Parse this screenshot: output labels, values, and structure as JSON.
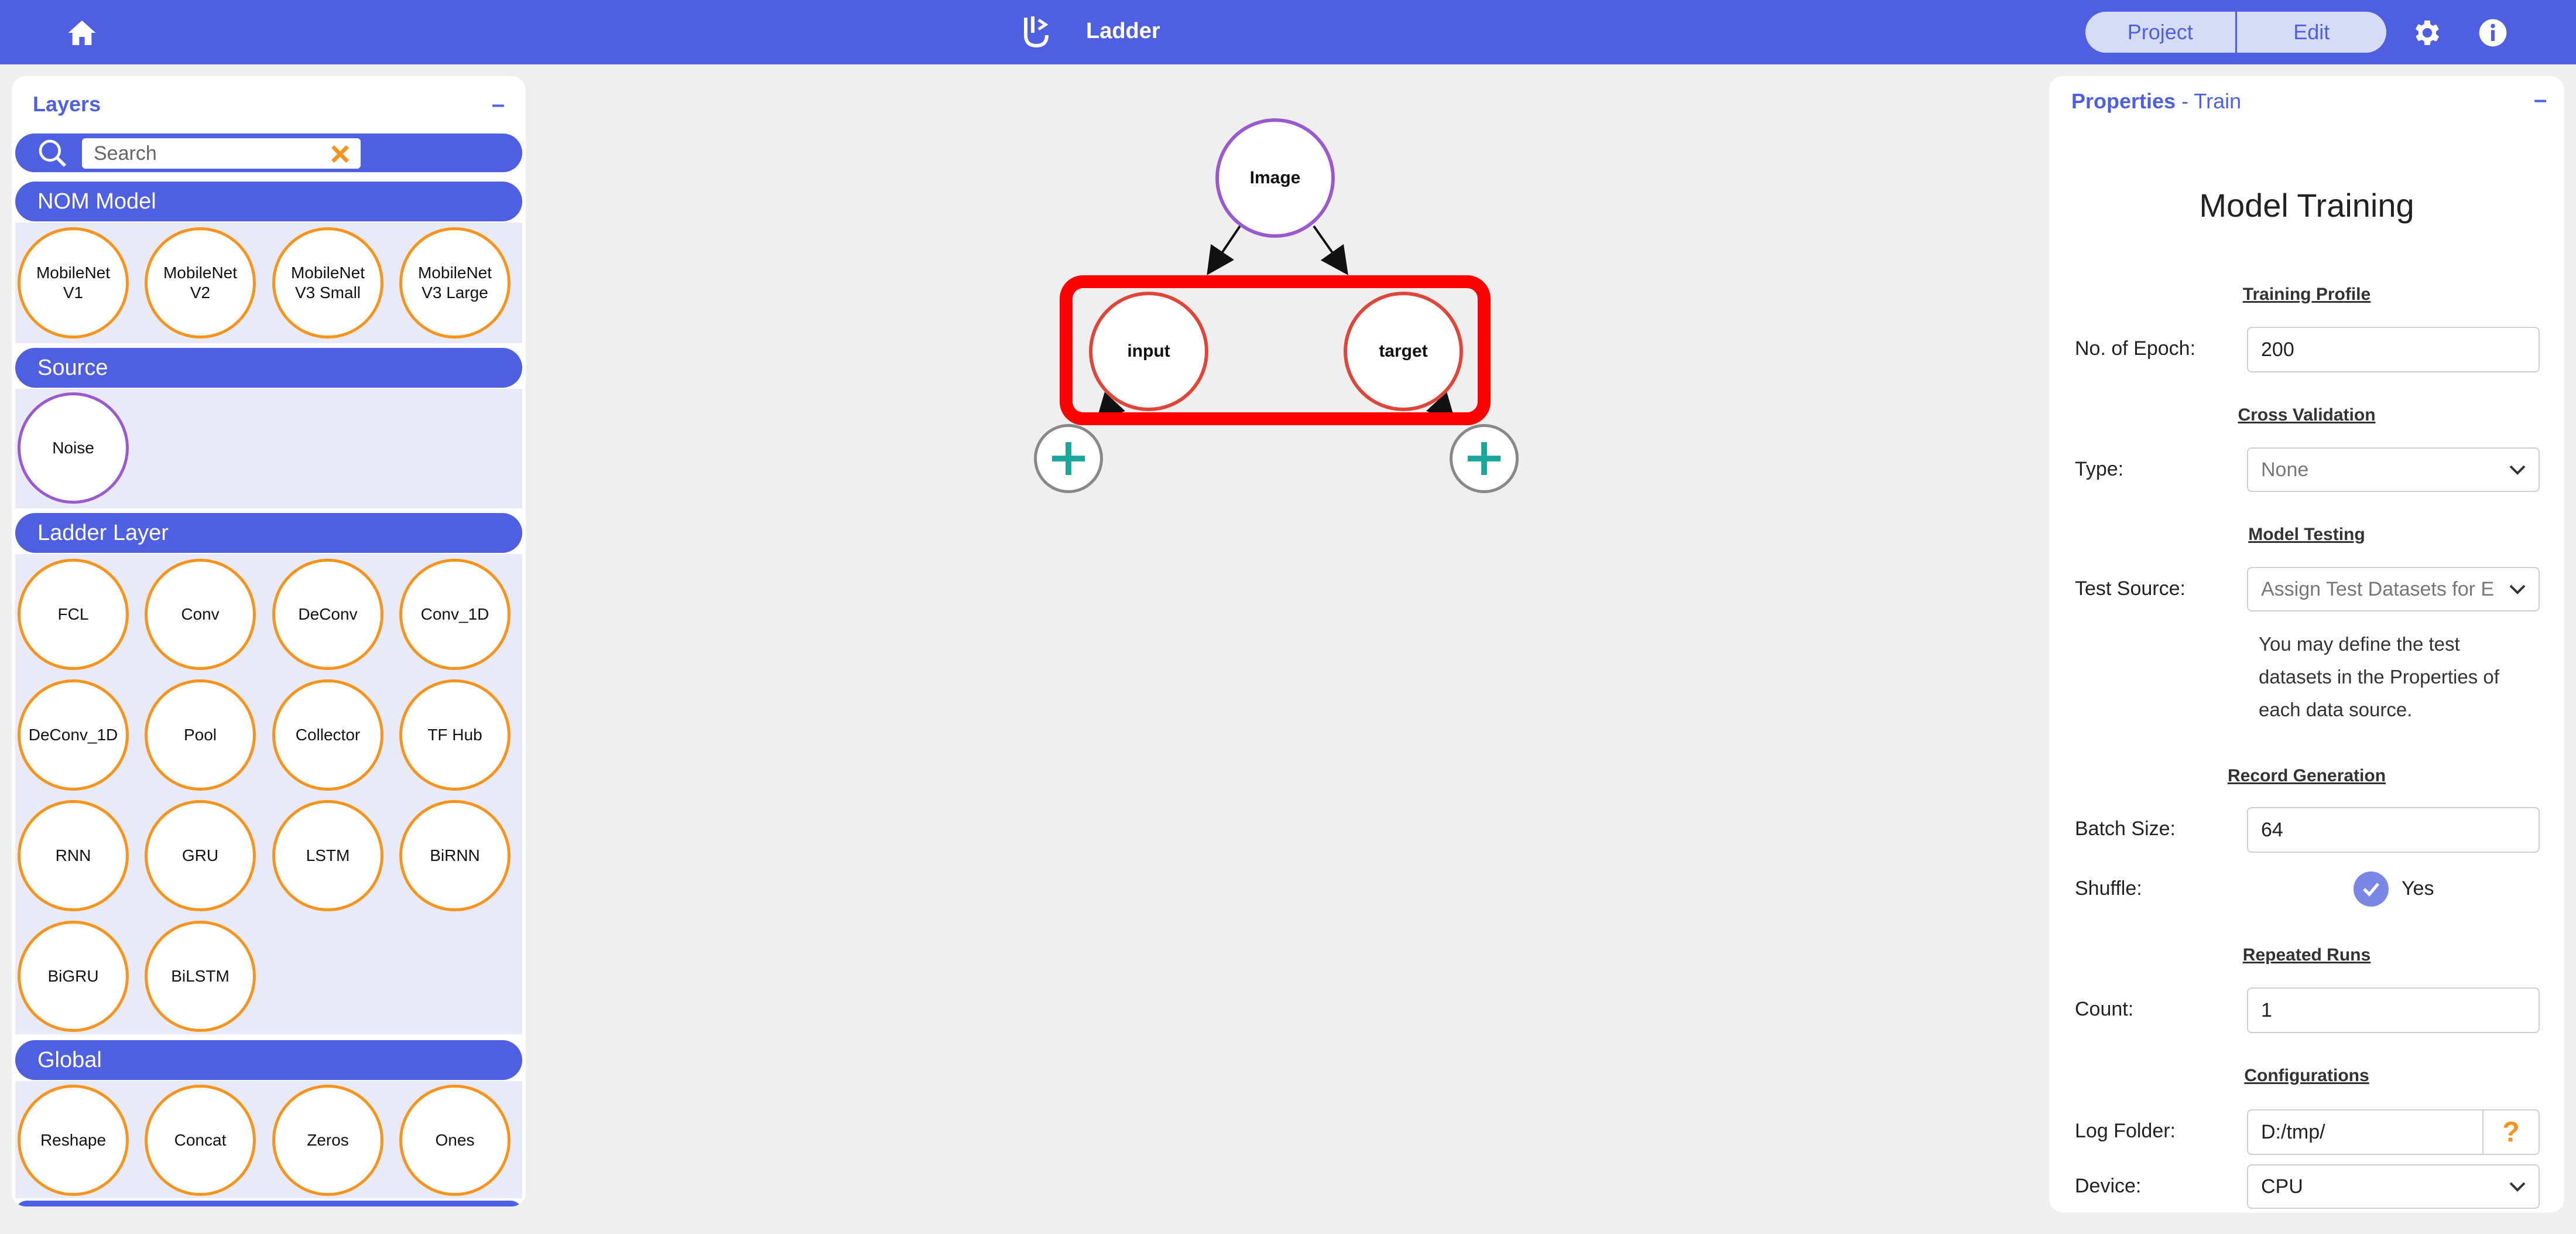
{
  "app": {
    "title": "Ladder",
    "modes": [
      "Project",
      "Edit"
    ]
  },
  "layers": {
    "title": "Layers",
    "minimize": "–",
    "search_placeholder": "Search",
    "sections": [
      {
        "name": "NOM Model",
        "items": [
          "MobileNet V1",
          "MobileNet V2",
          "MobileNet V3 Small",
          "MobileNet V3 Large"
        ]
      },
      {
        "name": "Source",
        "items": [
          "Noise"
        ]
      },
      {
        "name": "Ladder Layer",
        "items": [
          "FCL",
          "Conv",
          "DeConv",
          "Conv_1D",
          "DeConv_1D",
          "Pool",
          "Collector",
          "TF Hub",
          "RNN",
          "GRU",
          "LSTM",
          "BiRNN",
          "BiGRU",
          "BiLSTM"
        ]
      },
      {
        "name": "Global",
        "items": [
          "Reshape",
          "Concat",
          "Zeros",
          "Ones"
        ]
      }
    ]
  },
  "graph": {
    "nodes": {
      "image": "Image",
      "input": "input",
      "target": "target"
    }
  },
  "properties": {
    "title": "Properties",
    "subtitle": " - Train",
    "minimize": "–",
    "heading": "Model Training",
    "training_profile": "Training Profile",
    "epoch_label": "No. of Epoch:",
    "epoch_value": "200",
    "cross_validation": "Cross Validation",
    "type_label": "Type:",
    "type_value": "None",
    "model_testing": "Model Testing",
    "test_source_label": "Test Source:",
    "test_source_value": "Assign Test Datasets for E",
    "test_help": "You may define the test datasets in the Properties of each data source.",
    "record_generation": "Record Generation",
    "batch_label": "Batch Size:",
    "batch_value": "64",
    "shuffle_label": "Shuffle:",
    "shuffle_value": "Yes",
    "repeated_runs": "Repeated Runs",
    "count_label": "Count:",
    "count_value": "1",
    "configurations": "Configurations",
    "log_label": "Log Folder:",
    "log_value": "D:/tmp/",
    "help_mark": "?",
    "device_label": "Device:",
    "device_value": "CPU"
  },
  "colors": {
    "primary": "#4f5fe2",
    "node_orange": "#f7941d",
    "node_purple": "#9b59d0",
    "node_red": "#e0453a",
    "highlight": "#ff0000",
    "add_teal": "#1aa69a"
  }
}
